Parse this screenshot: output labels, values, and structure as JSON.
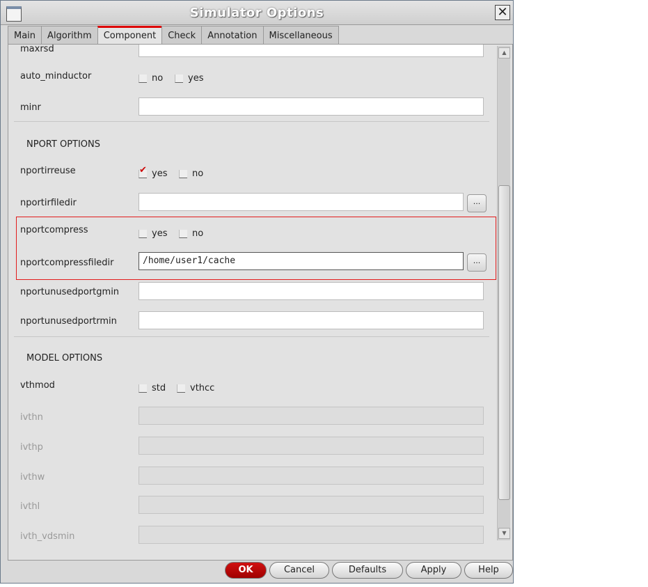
{
  "window": {
    "title": "Simulator Options"
  },
  "tabs": [
    "Main",
    "Algorithm",
    "Component",
    "Check",
    "Annotation",
    "Miscellaneous"
  ],
  "active_tab": "Component",
  "fields": {
    "maxrsd": {
      "label": "maxrsd",
      "value": ""
    },
    "auto_minductor": {
      "label": "auto_minductor",
      "opt1": "no",
      "opt2": "yes"
    },
    "minr": {
      "label": "minr",
      "value": ""
    },
    "nport_section": "NPORT OPTIONS",
    "nportirreuse": {
      "label": "nportirreuse",
      "opt1": "yes",
      "opt2": "no",
      "checked": "yes"
    },
    "nportirfiledir": {
      "label": "nportirfiledir",
      "value": "",
      "browse": "..."
    },
    "nportcompress": {
      "label": "nportcompress",
      "opt1": "yes",
      "opt2": "no"
    },
    "nportcompressfiledir": {
      "label": "nportcompressfiledir",
      "value": "/home/user1/cache",
      "browse": "..."
    },
    "nportunusedportgmin": {
      "label": "nportunusedportgmin",
      "value": ""
    },
    "nportunusedportrmin": {
      "label": "nportunusedportrmin",
      "value": ""
    },
    "model_section": "MODEL OPTIONS",
    "vthmod": {
      "label": "vthmod",
      "opt1": "std",
      "opt2": "vthcc"
    },
    "ivthn": {
      "label": "ivthn"
    },
    "ivthp": {
      "label": "ivthp"
    },
    "ivthw": {
      "label": "ivthw"
    },
    "ivthl": {
      "label": "ivthl"
    },
    "ivth_vdsmin": {
      "label": "ivth_vdsmin"
    }
  },
  "buttons": {
    "ok": "OK",
    "cancel": "Cancel",
    "defaults": "Defaults",
    "apply": "Apply",
    "help": "Help"
  },
  "colors": {
    "accent": "#e21b1b",
    "ok": "#b00000"
  }
}
